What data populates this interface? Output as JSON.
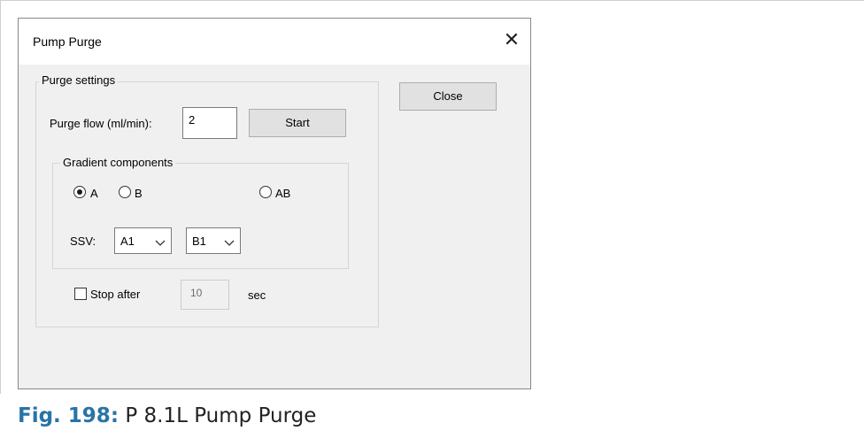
{
  "window": {
    "title": "Pump Purge",
    "close_icon": "close-icon"
  },
  "purge_settings": {
    "group_label": "Purge settings",
    "flow_label": "Purge flow (ml/min):",
    "flow_value": "2",
    "start_label": "Start",
    "close_label": "Close"
  },
  "gradient": {
    "group_label": "Gradient components",
    "options": [
      {
        "label": "A",
        "checked": true
      },
      {
        "label": "B",
        "checked": false
      },
      {
        "label": "AB",
        "checked": false
      }
    ],
    "ssv_label": "SSV:",
    "ssv_a_value": "A1",
    "ssv_b_value": "B1"
  },
  "stop_after": {
    "label": "Stop after",
    "checked": false,
    "value": "10",
    "unit": "sec"
  },
  "caption": {
    "figure": "Fig. 198:",
    "text": "P 8.1L Pump Purge"
  }
}
